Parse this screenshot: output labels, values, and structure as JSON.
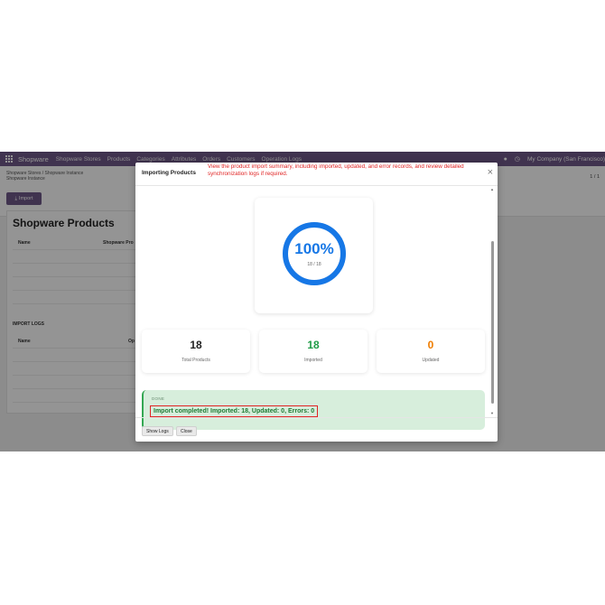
{
  "navbar": {
    "brand": "Shopware",
    "menu": [
      "Shopware Stores",
      "Products",
      "Categories",
      "Attributes",
      "Orders",
      "Customers",
      "Operation Logs"
    ],
    "company": "My Company (San Francisco)"
  },
  "breadcrumb": {
    "path": "Shopware Stores / Shopware Instance",
    "current": "Shopware Instance"
  },
  "pager": "1 / 1",
  "import_button": "Import",
  "sheet": {
    "title": "Shopware Products",
    "products_headers": [
      "Name",
      "Shopware Pro"
    ],
    "logs_section": "IMPORT LOGS",
    "logs_headers": [
      "Name",
      "Op"
    ]
  },
  "dialog": {
    "title": "Importing Products",
    "annotation": "View the product import summary, including imported, updated, and error records, and review detailed synchronization logs if required.",
    "progress": {
      "percent_label": "100%",
      "fraction_label": "18 / 18",
      "value": 1.0,
      "color": "#1677e6"
    },
    "stats": [
      {
        "value": "18",
        "label": "Total Products",
        "color": "#222222"
      },
      {
        "value": "18",
        "label": "Imported",
        "color": "#1e9b46"
      },
      {
        "value": "0",
        "label": "Updated",
        "color": "#ef7d00"
      }
    ],
    "status_label": "DONE",
    "result_message": "Import completed! Imported: 18, Updated: 0, Errors: 0",
    "footer": {
      "show_logs": "Show Logs",
      "close": "Close"
    }
  }
}
